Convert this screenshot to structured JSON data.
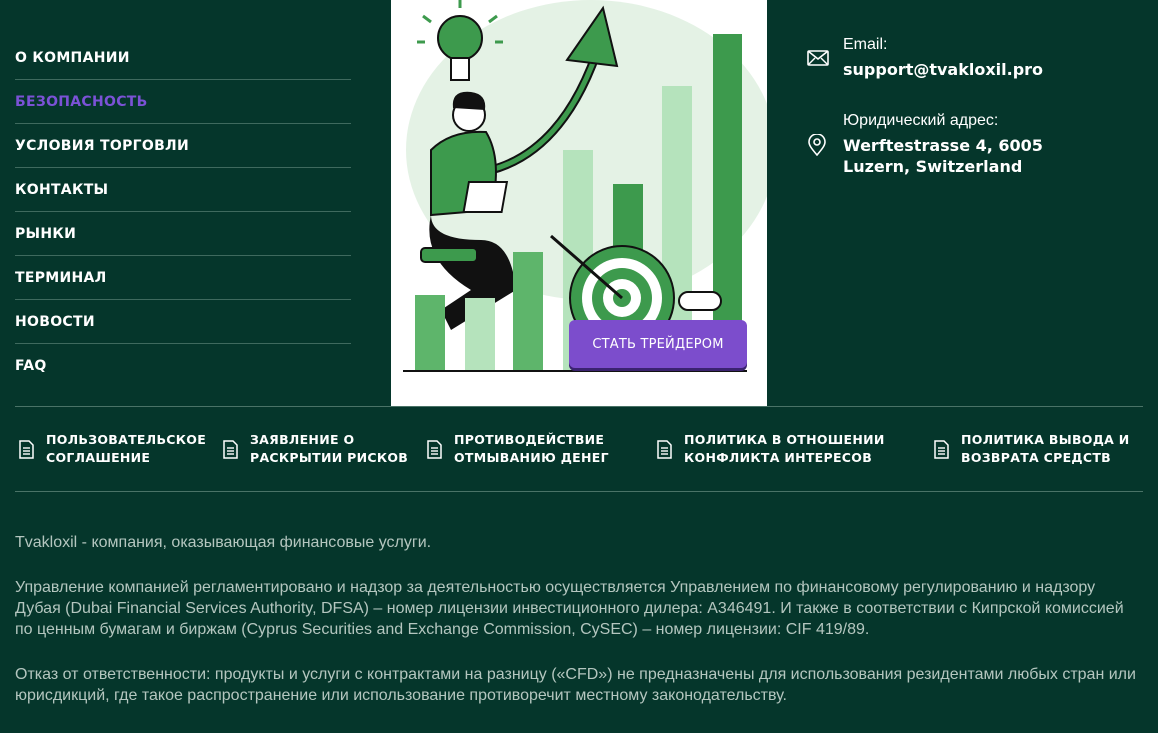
{
  "nav": {
    "items": [
      {
        "label": "О КОМПАНИИ"
      },
      {
        "label": "БЕЗОПАСНОСТЬ"
      },
      {
        "label": "УСЛОВИЯ ТОРГОВЛИ"
      },
      {
        "label": "КОНТАКТЫ"
      },
      {
        "label": "РЫНКИ"
      },
      {
        "label": "ТЕРМИНАЛ"
      },
      {
        "label": "НОВОСТИ"
      },
      {
        "label": "FAQ"
      }
    ],
    "active_color": "#7b52d6"
  },
  "hero": {
    "cta_label": "СТАТЬ ТРЕЙДЕРОМ",
    "cta_color": "#7c4dcc",
    "illustration_colors": {
      "dark": "#3d9a4d",
      "mid": "#5eb56b",
      "light": "#b5e3bc",
      "pale": "#e4f2e5"
    }
  },
  "contacts": {
    "email_label": "Email:",
    "email": "support@tvakloxil.pro",
    "address_label": "Юридический адрес:",
    "address_line1": "Werftestrasse 4, 6005",
    "address_line2": "Luzern, Switzerland"
  },
  "documents": [
    {
      "line1": "ПОЛЬЗОВАТЕЛЬСКОЕ",
      "line2": "СОГЛАШЕНИЕ",
      "icon": "document-icon"
    },
    {
      "line1": "ЗАЯВЛЕНИЕ О",
      "line2": "РАСКРЫТИИ РИСКОВ",
      "icon": "document-icon"
    },
    {
      "line1": "ПРОТИВОДЕЙСТВИЕ",
      "line2": "ОТМЫВАНИЮ ДЕНЕГ",
      "icon": "document-icon"
    },
    {
      "line1": "ПОЛИТИКА В ОТНОШЕНИИ",
      "line2": "КОНФЛИКТА ИНТЕРЕСОВ",
      "icon": "document-icon"
    },
    {
      "line1": "ПОЛИТИКА ВЫВОДА И",
      "line2": "ВОЗВРАТА СРЕДСТВ",
      "icon": "document-icon"
    }
  ],
  "legal": {
    "p1": "Tvakloxil - компания, оказывающая финансовые услуги.",
    "p2": "Управление компанией регламентировано и надзор за деятельностью осуществляется Управлением по финансовому регулированию и надзору Дубая (Dubai Financial Services Authority, DFSA) – номер лицензии инвестиционного дилера: A346491. И также в соответствии с Кипрской комиссией по ценным бумагам и биржам (Cyprus Securities and Exchange Commission, CySEC) – номер лицензии: CIF 419/89.",
    "p3": "Отказ от ответственности: продукты и услуги с контрактами на разницу («CFD») не предназначены для использования резидентами любых стран или юрисдикций, где такое распространение или использование противоречит местному законодательству."
  },
  "theme": {
    "background": "#05362b",
    "divider": "#4a7367",
    "legal_text": "#b4c6bf"
  }
}
